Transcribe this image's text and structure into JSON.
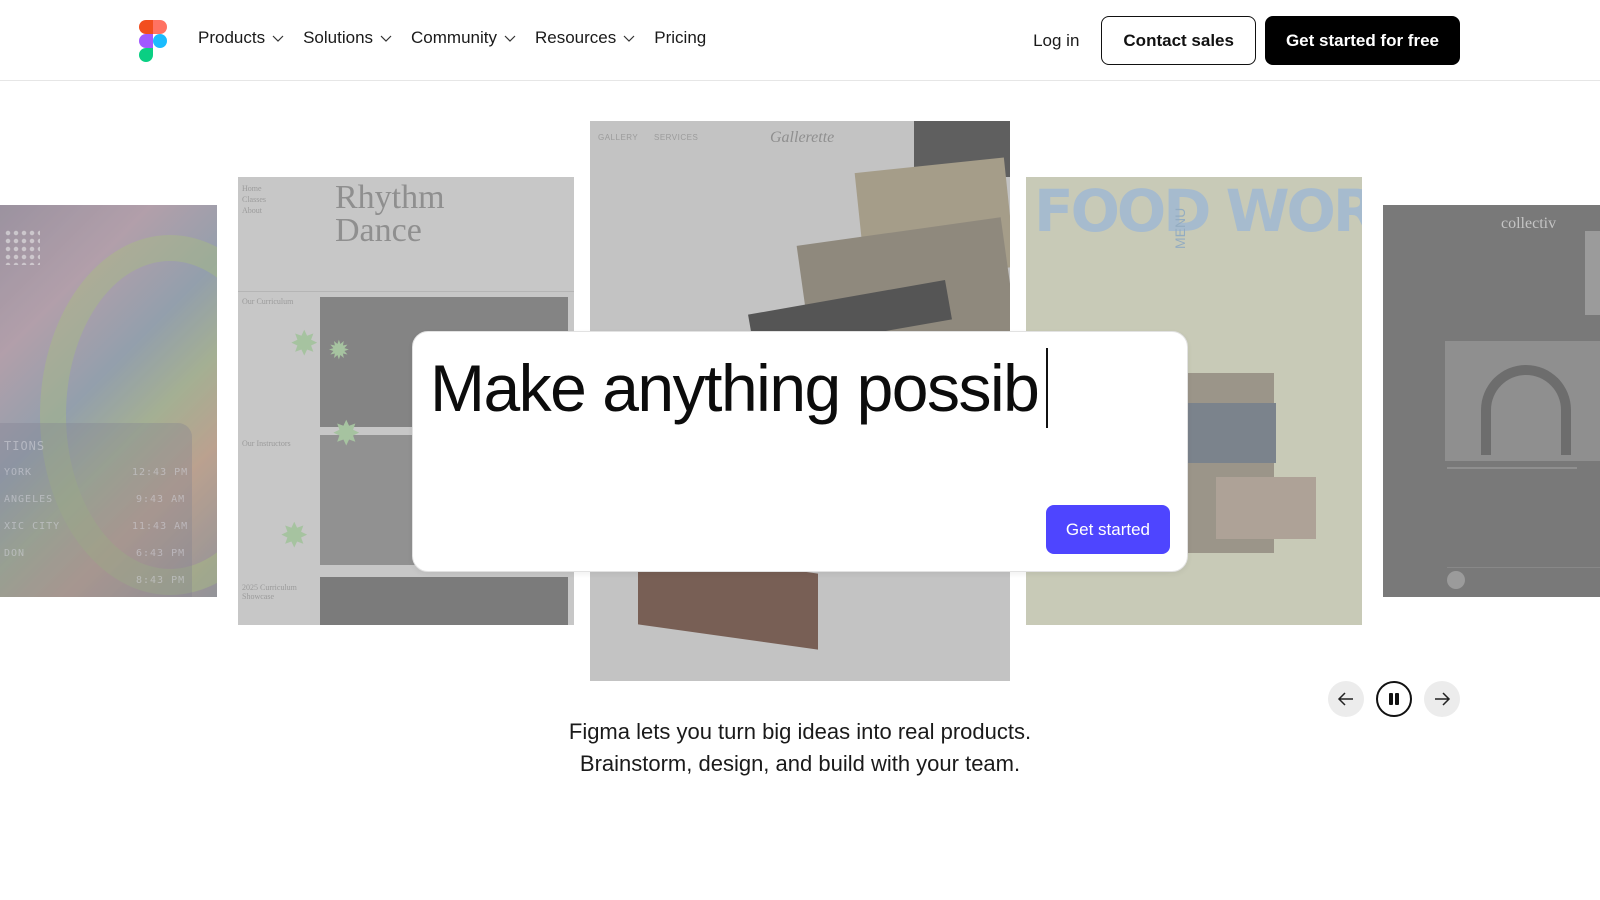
{
  "header": {
    "nav": [
      {
        "label": "Products",
        "has_dropdown": true
      },
      {
        "label": "Solutions",
        "has_dropdown": true
      },
      {
        "label": "Community",
        "has_dropdown": true
      },
      {
        "label": "Resources",
        "has_dropdown": true
      },
      {
        "label": "Pricing",
        "has_dropdown": false
      }
    ],
    "login_label": "Log in",
    "contact_label": "Contact sales",
    "get_started_free_label": "Get started for free"
  },
  "carousel": {
    "cards": [
      {
        "name": "music-app-card",
        "texts": [
          "TIONS",
          "YORK",
          "ANGELES",
          "XIC CITY",
          "DON",
          "12:43 PM",
          "9:43 AM",
          "11:43 AM",
          "6:43 PM",
          "8:43 PM"
        ]
      },
      {
        "name": "rhythm-dance-card",
        "title_line1": "Rhythm",
        "title_line2": "Dance",
        "menu": [
          "Home",
          "Classes",
          "About"
        ],
        "labels": [
          "Our Curriculum",
          "Our Instructors",
          "2025 Curriculum Showcase"
        ]
      },
      {
        "name": "gallerette-card",
        "nav": [
          "GALLERY",
          "SERVICES"
        ],
        "brand": "Gallerette"
      },
      {
        "name": "food-works-card",
        "title": "FOOD WORKS",
        "menu_vertical": "MENU"
      },
      {
        "name": "collectiv-card",
        "brand": "collectiv"
      }
    ],
    "controls": {
      "prev": "previous",
      "pause": "pause",
      "next": "next"
    }
  },
  "prompt": {
    "text": "Make anything possib",
    "button_label": "Get started"
  },
  "tagline": {
    "line1": "Figma lets you turn big ideas into real products.",
    "line2": "Brainstorm, design, and build with your team."
  },
  "colors": {
    "accent": "#4e45ff",
    "primary_button": "#000000",
    "logo": [
      "#f24e1e",
      "#ff7262",
      "#a259ff",
      "#1abcfe",
      "#0acf83"
    ]
  },
  "icons": [
    "figma-logo-icon",
    "chevron-down-icon",
    "arrow-left-icon",
    "pause-icon",
    "arrow-right-icon"
  ]
}
